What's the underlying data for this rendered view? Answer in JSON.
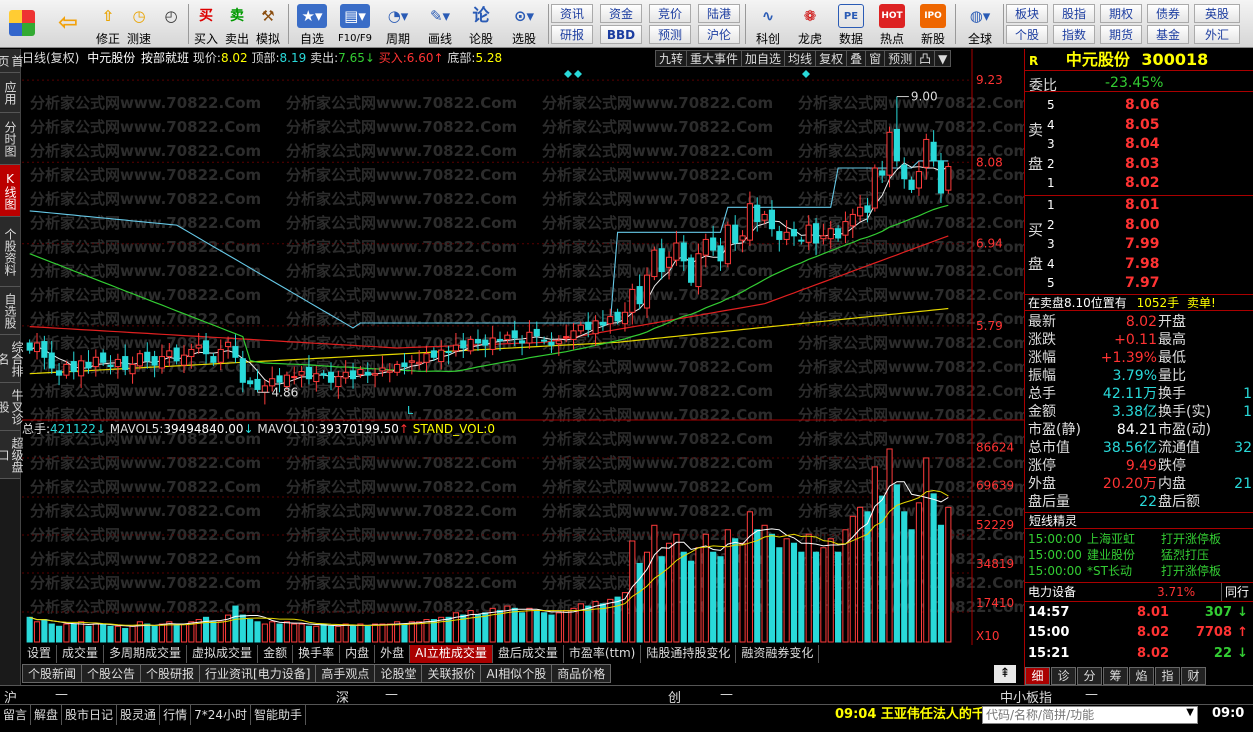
{
  "toolbar": {
    "buttons": [
      {
        "label": "",
        "icon": "home-logo-icon"
      },
      {
        "label": "",
        "icon": "back-arrow-icon"
      },
      {
        "label": "修正",
        "icon": "up-arrow-icon"
      },
      {
        "label": "测速",
        "icon": "clock-icon"
      },
      {
        "label": "买入",
        "icon": "buy-icon",
        "glyph": "买"
      },
      {
        "label": "卖出",
        "icon": "sell-icon",
        "glyph": "卖"
      },
      {
        "label": "模拟",
        "icon": "hammer-icon"
      },
      {
        "label": "自选",
        "icon": "star-icon"
      },
      {
        "label": "F10/F9",
        "icon": "window-icon"
      },
      {
        "label": "周期",
        "icon": "period-icon"
      },
      {
        "label": "画线",
        "icon": "pencil-icon"
      },
      {
        "label": "论股",
        "icon": "discuss-icon",
        "glyph": "论"
      },
      {
        "label": "选股",
        "icon": "select-stock-icon"
      }
    ],
    "small_buttons": [
      [
        "资讯",
        "资金",
        "竞价",
        "陆港"
      ],
      [
        "研报",
        "BBD",
        "预测",
        "沪伦"
      ]
    ],
    "big_buttons2": [
      {
        "label": "科创",
        "icon": "kechuang-icon"
      },
      {
        "label": "龙虎",
        "icon": "dragon-tiger-icon"
      },
      {
        "label": "数据",
        "icon": "pe-icon",
        "glyph": "PE"
      },
      {
        "label": "热点",
        "icon": "hot-icon",
        "glyph": "HOT"
      },
      {
        "label": "新股",
        "icon": "ipo-icon",
        "glyph": "IPO"
      },
      {
        "label": "全球",
        "icon": "globe-icon"
      }
    ],
    "right_small": [
      [
        "板块",
        "股指",
        "期权",
        "债券",
        "英股"
      ],
      [
        "个股",
        "指数",
        "期货",
        "基金",
        "外汇"
      ]
    ]
  },
  "leftnav": [
    "首页",
    "应用",
    "分时图",
    "K线图",
    "个股资料",
    "自选股",
    "综合排名",
    "牛叉诊股",
    "超级盘口"
  ],
  "leftnav_active": 3,
  "header": {
    "period": "日线(复权)",
    "stock": "中元股份",
    "mode": "按部就班",
    "price_label": "现价:",
    "price": "8.02",
    "top_label": "顶部:",
    "top": "8.19",
    "sell_label": "卖出:",
    "sell": "7.65",
    "buy_label": "买入:",
    "buy": "6.60",
    "bottom_label": "底部:",
    "bottom": "5.28"
  },
  "chart_tools": [
    "九转",
    "重大事件",
    "加自选",
    "均线",
    "复权",
    "叠",
    "窗",
    "预测",
    "凸",
    "▼"
  ],
  "price_axis": [
    "9.23",
    "8.08",
    "6.94",
    "5.79"
  ],
  "volume_axis": [
    "86624",
    "69639",
    "52229",
    "34819",
    "17410",
    "X10"
  ],
  "price_annotations": {
    "high": "9.00",
    "low": "4.86",
    "marker": "L"
  },
  "volume_header": {
    "total_label": "总手:",
    "total": "421122",
    "mavol5_label": "MAVOL5:",
    "mavol5": "39494840.00",
    "mavol10_label": "MAVOL10:",
    "mavol10": "39370199.50",
    "stand_label": "STAND_VOL:",
    "stand": "0"
  },
  "watermark": "分析家公式网www.70822.Com",
  "indicator_tabs": [
    "设置",
    "成交量",
    "多周期成交量",
    "虚拟成交量",
    "金额",
    "换手率",
    "内盘",
    "外盘",
    "AI立桩成交量",
    "盘后成交量",
    "市盈率(ttm)",
    "陆股通持股变化",
    "融资融券变化"
  ],
  "indicator_active": 8,
  "info_tabs": [
    "个股新闻",
    "个股公告",
    "个股研报",
    "行业资讯[电力设备]",
    "高手观点",
    "论股堂",
    "关联报价",
    "AI相似个股",
    "商品价格"
  ],
  "right_panel": {
    "flag": "R",
    "name": "中元股份",
    "code": "300018",
    "weibi_label": "委比",
    "weibi": "-23.45%",
    "sell_side_label": [
      "卖",
      "盘"
    ],
    "buy_side_label": [
      "买",
      "盘"
    ],
    "asks": [
      {
        "lvl": "5",
        "price": "8.06"
      },
      {
        "lvl": "4",
        "price": "8.05"
      },
      {
        "lvl": "3",
        "price": "8.04"
      },
      {
        "lvl": "2",
        "price": "8.03"
      },
      {
        "lvl": "1",
        "price": "8.02"
      }
    ],
    "bids": [
      {
        "lvl": "1",
        "price": "8.01"
      },
      {
        "lvl": "2",
        "price": "8.00"
      },
      {
        "lvl": "3",
        "price": "7.99"
      },
      {
        "lvl": "4",
        "price": "7.98"
      },
      {
        "lvl": "5",
        "price": "7.97"
      }
    ],
    "position_text": "在卖盘8.10位置有",
    "position_vol": "1052手",
    "position_tag": "卖单!",
    "quotes": [
      {
        "l": "最新",
        "v": "8.02",
        "l2": "开盘",
        "v2": ""
      },
      {
        "l": "涨跌",
        "v": "+0.11",
        "l2": "最高",
        "v2": ""
      },
      {
        "l": "涨幅",
        "v": "+1.39%",
        "l2": "最低",
        "v2": ""
      },
      {
        "l": "振幅",
        "v": "3.79%",
        "l2": "量比",
        "v2": ""
      },
      {
        "l": "总手",
        "v": "42.11万",
        "l2": "换手",
        "v2": "1"
      },
      {
        "l": "金额",
        "v": "3.38亿",
        "l2": "换手(实)",
        "v2": "1"
      },
      {
        "l": "市盈(静)",
        "v": "84.21",
        "l2": "市盈(动)",
        "v2": ""
      },
      {
        "l": "总市值",
        "v": "38.56亿",
        "l2": "流通值",
        "v2": "32"
      },
      {
        "l": "涨停",
        "v": "9.49",
        "l2": "跌停",
        "v2": ""
      },
      {
        "l": "外盘",
        "v": "20.20万",
        "l2": "内盘",
        "v2": "21"
      },
      {
        "l": "盘后量",
        "v": "22",
        "l2": "盘后额",
        "v2": ""
      }
    ],
    "short_title": "短线精灵",
    "short_items": [
      {
        "time": "15:00:00",
        "name": "上海亚虹",
        "event": "打开涨停板"
      },
      {
        "time": "15:00:00",
        "name": "建业股份",
        "event": "猛烈打压"
      },
      {
        "time": "15:00:00",
        "name": "*ST长动",
        "event": "打开涨停板"
      }
    ],
    "sector_name": "电力设备",
    "sector_change": "3.71%",
    "sector_more": "同行",
    "ticks": [
      {
        "time": "14:57",
        "price": "8.01",
        "vol": "307",
        "dir": "down"
      },
      {
        "time": "15:00",
        "price": "8.02",
        "vol": "7708",
        "dir": "up"
      },
      {
        "time": "15:21",
        "price": "8.02",
        "vol": "22",
        "dir": "down"
      }
    ],
    "bottom_tabs": [
      "细",
      "诊",
      "分",
      "筹",
      "焰",
      "指",
      "财"
    ]
  },
  "market_bar": {
    "sh": "沪",
    "sh_dash": "—",
    "sz": "深",
    "sz_dash": "—",
    "cy": "创",
    "cy_dash": "—",
    "small_board": "中小板指",
    "small_dash": "—"
  },
  "status_bar": {
    "items": [
      "留言",
      "解盘",
      "股市日记",
      "股灵通",
      "行情",
      "7*24小时",
      "智能助手"
    ],
    "news_time": "09:04",
    "news": "王亚伟任法人的千",
    "search_placeholder": "代码/名称/简拼/功能",
    "clock": "09:0"
  },
  "colors": {
    "up": "#ff3b3b",
    "down": "#29d9d9",
    "accent_yellow": "#ffff00",
    "ma_green": "#33cc33",
    "ma_red": "#e02020"
  },
  "chart_data": {
    "type": "candlestick",
    "title": "日线(复权) 中元股份",
    "ylim": [
      4.5,
      9.4
    ],
    "price_ticks": [
      9.23,
      8.08,
      6.94,
      5.79
    ],
    "high_marker": 9.0,
    "low_marker": 4.86,
    "closes": [
      5.45,
      5.55,
      5.35,
      5.2,
      5.1,
      5.25,
      5.15,
      5.3,
      5.2,
      5.35,
      5.28,
      5.22,
      5.32,
      5.18,
      5.25,
      5.4,
      5.3,
      5.24,
      5.36,
      5.44,
      5.3,
      5.38,
      5.46,
      5.52,
      5.4,
      5.28,
      5.46,
      5.56,
      5.35,
      5.0,
      4.98,
      4.9,
      4.95,
      5.05,
      5.0,
      5.1,
      5.08,
      5.15,
      5.05,
      5.12,
      5.1,
      5.0,
      5.08,
      5.14,
      5.05,
      5.18,
      5.1,
      5.12,
      5.2,
      5.16,
      5.25,
      5.22,
      5.3,
      5.28,
      5.4,
      5.35,
      5.45,
      5.42,
      5.52,
      5.48,
      5.6,
      5.55,
      5.52,
      5.62,
      5.58,
      5.66,
      5.62,
      5.55,
      5.7,
      5.65,
      5.58,
      5.52,
      5.58,
      5.64,
      5.72,
      5.8,
      5.74,
      5.86,
      5.8,
      5.92,
      5.86,
      5.98,
      6.3,
      6.1,
      6.5,
      6.85,
      6.55,
      6.75,
      6.95,
      6.7,
      6.4,
      6.8,
      7.0,
      6.85,
      6.7,
      7.2,
      6.95,
      7.05,
      7.5,
      7.25,
      7.35,
      7.15,
      7.0,
      7.1,
      7.05,
      6.98,
      7.2,
      6.95,
      7.05,
      7.15,
      7.02,
      7.25,
      7.35,
      7.45,
      7.38,
      8.0,
      7.9,
      8.5,
      8.1,
      7.85,
      7.7,
      7.95,
      8.4,
      8.1,
      7.65,
      8.02
    ],
    "volumes": [
      11,
      9,
      10,
      8,
      7,
      8,
      8,
      9,
      7,
      8,
      8,
      7,
      7,
      6,
      7,
      9,
      8,
      7,
      8,
      9,
      8,
      8,
      9,
      10,
      11,
      9,
      9,
      12,
      16,
      12,
      10,
      9,
      8,
      9,
      8,
      9,
      8,
      8,
      7,
      7,
      8,
      7,
      7,
      8,
      7,
      8,
      7,
      8,
      8,
      8,
      9,
      8,
      9,
      9,
      10,
      10,
      11,
      11,
      13,
      12,
      14,
      12,
      13,
      15,
      14,
      16,
      15,
      13,
      15,
      14,
      13,
      12,
      13,
      14,
      15,
      17,
      16,
      18,
      17,
      19,
      20,
      22,
      45,
      35,
      40,
      52,
      38,
      44,
      48,
      40,
      36,
      42,
      48,
      40,
      38,
      50,
      46,
      44,
      58,
      50,
      52,
      48,
      42,
      46,
      44,
      40,
      48,
      40,
      42,
      46,
      40,
      50,
      56,
      60,
      58,
      78,
      65,
      86,
      70,
      58,
      50,
      62,
      82,
      66,
      52,
      60
    ],
    "mavol_ylim": [
      0,
      90
    ]
  }
}
